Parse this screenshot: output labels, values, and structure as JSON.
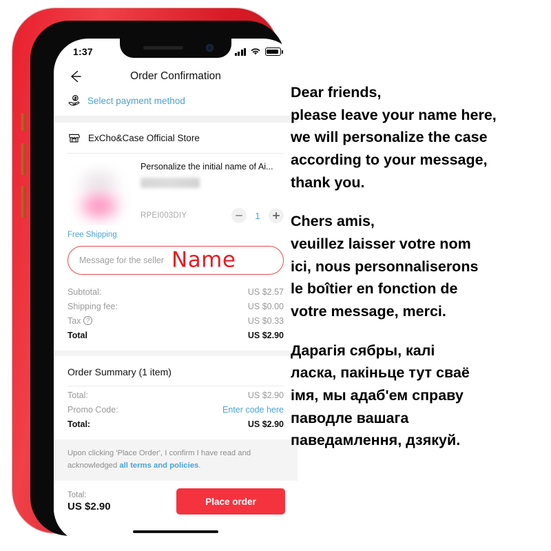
{
  "phone": {
    "status_bar": {
      "time": "1:37",
      "signal_icon": "signal-bars-icon",
      "wifi_icon": "wifi-icon",
      "battery_icon": "battery-icon"
    },
    "nav": {
      "back_icon": "back-arrow-icon",
      "title": "Order Confirmation"
    },
    "payment": {
      "icon": "hand-coin-icon",
      "label": "Select payment method"
    },
    "store": {
      "icon": "storefront-icon",
      "name": "ExCho&Case Official Store"
    },
    "product": {
      "image": "blurred-pink-airpods-case",
      "title": "Personalize the initial name of Ai...",
      "variant_redacted": "",
      "sku": "RPEI003DIY",
      "qty": "1",
      "minus_icon": "minus-icon",
      "plus_icon": "plus-icon",
      "free_shipping": "Free Shipping"
    },
    "message_box": {
      "placeholder": "Message for the seller",
      "annotation": "Name"
    },
    "price_rows": [
      {
        "label": "Subtotal:",
        "value": "US $2.57",
        "strong": false,
        "help": false
      },
      {
        "label": "Shipping fee:",
        "value": "US $0.00",
        "strong": false,
        "help": false
      },
      {
        "label": "Tax",
        "value": "US $0.33",
        "strong": false,
        "help": true
      },
      {
        "label": "Total",
        "value": "US $2.90",
        "strong": true,
        "help": false
      }
    ],
    "order_summary": {
      "title": "Order Summary (1 item)",
      "rows": [
        {
          "label": "Total:",
          "value": "US $2.90",
          "strong": false,
          "link": false
        },
        {
          "label": "Promo Code:",
          "value": "Enter code here",
          "strong": false,
          "link": true
        },
        {
          "label": "Total:",
          "value": "US $2.90",
          "strong": true,
          "link": false
        }
      ]
    },
    "terms": {
      "text_before": "Upon clicking 'Place Order', I confirm I have read and acknowledged ",
      "link": "all terms and policies",
      "text_after": "."
    },
    "checkout": {
      "total_label": "Total:",
      "total_value": "US $2.90",
      "button": "Place order"
    }
  },
  "notes": {
    "english": [
      "Dear friends,",
      "please leave your name here,",
      "we will personalize the case",
      "according to your message,",
      "thank you."
    ],
    "french": [
      "Chers amis,",
      "veuillez laisser votre nom",
      "ici, nous personnaliserons",
      "le boîtier en fonction de",
      "votre message, merci."
    ],
    "belarusian": [
      "Дарагія сябры, калі",
      "ласка, пакіньце тут сваё",
      "імя, мы адаб'ем справу",
      "паводле вашага",
      "паведамлення, дзякуй."
    ]
  },
  "colors": {
    "brand_red": "#f5333f",
    "link_blue": "#4aa3d4",
    "annotation_red": "#e81b23",
    "frame_red": "#e8202e"
  }
}
